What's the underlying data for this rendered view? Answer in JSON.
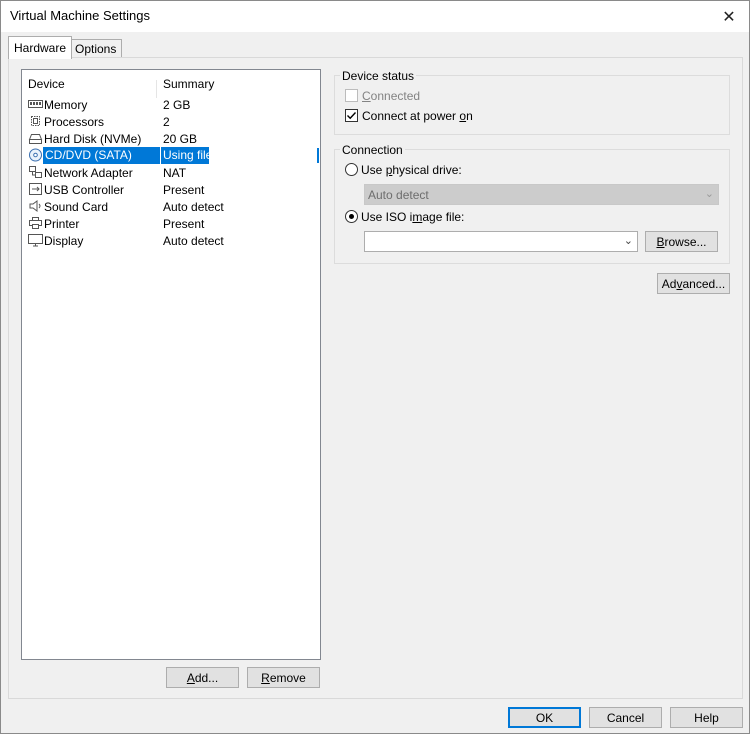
{
  "window": {
    "title": "Virtual Machine Settings",
    "close_glyph": "✕"
  },
  "tabs": [
    {
      "label": "Hardware",
      "active": true
    },
    {
      "label": "Options",
      "active": false
    }
  ],
  "device_list": {
    "columns": {
      "device": "Device",
      "summary": "Summary"
    },
    "rows": [
      {
        "icon": "memory-icon",
        "device": "Memory",
        "summary": "2 GB"
      },
      {
        "icon": "processor-icon",
        "device": "Processors",
        "summary": "2"
      },
      {
        "icon": "hard-disk-icon",
        "device": "Hard Disk (NVMe)",
        "summary": "20 GB"
      },
      {
        "icon": "cd-dvd-icon",
        "device": "CD/DVD (SATA)",
        "summary": "Using file",
        "selected": true
      },
      {
        "icon": "network-adapter-icon",
        "device": "Network Adapter",
        "summary": "NAT"
      },
      {
        "icon": "usb-icon",
        "device": "USB Controller",
        "summary": "Present"
      },
      {
        "icon": "sound-card-icon",
        "device": "Sound Card",
        "summary": "Auto detect"
      },
      {
        "icon": "printer-icon",
        "device": "Printer",
        "summary": "Present"
      },
      {
        "icon": "display-icon",
        "device": "Display",
        "summary": "Auto detect"
      }
    ]
  },
  "list_buttons": {
    "add_pre": "",
    "add_ul": "A",
    "add_post": "dd...",
    "remove_pre": "",
    "remove_ul": "R",
    "remove_post": "emove"
  },
  "device_status": {
    "legend": "Device status",
    "connected": {
      "label_pre": "",
      "label_ul": "C",
      "label_post": "onnected",
      "checked": false,
      "enabled": false
    },
    "connect_at_power_on": {
      "label_pre": "Connect at power ",
      "label_ul": "o",
      "label_post": "n",
      "checked": true
    }
  },
  "connection": {
    "legend": "Connection",
    "physical": {
      "label_pre": "Use ",
      "label_ul": "p",
      "label_post": "hysical drive:",
      "selected": false
    },
    "physical_select_value": "Auto detect",
    "iso": {
      "label_pre": "Use ISO i",
      "label_ul": "m",
      "label_post": "age file:",
      "selected": true
    },
    "iso_value": "",
    "browse": {
      "pre": "",
      "ul": "B",
      "post": "rowse..."
    }
  },
  "advanced": {
    "pre": "Ad",
    "ul": "v",
    "post": "anced..."
  },
  "footer": {
    "ok": "OK",
    "cancel": "Cancel",
    "help": "Help"
  }
}
